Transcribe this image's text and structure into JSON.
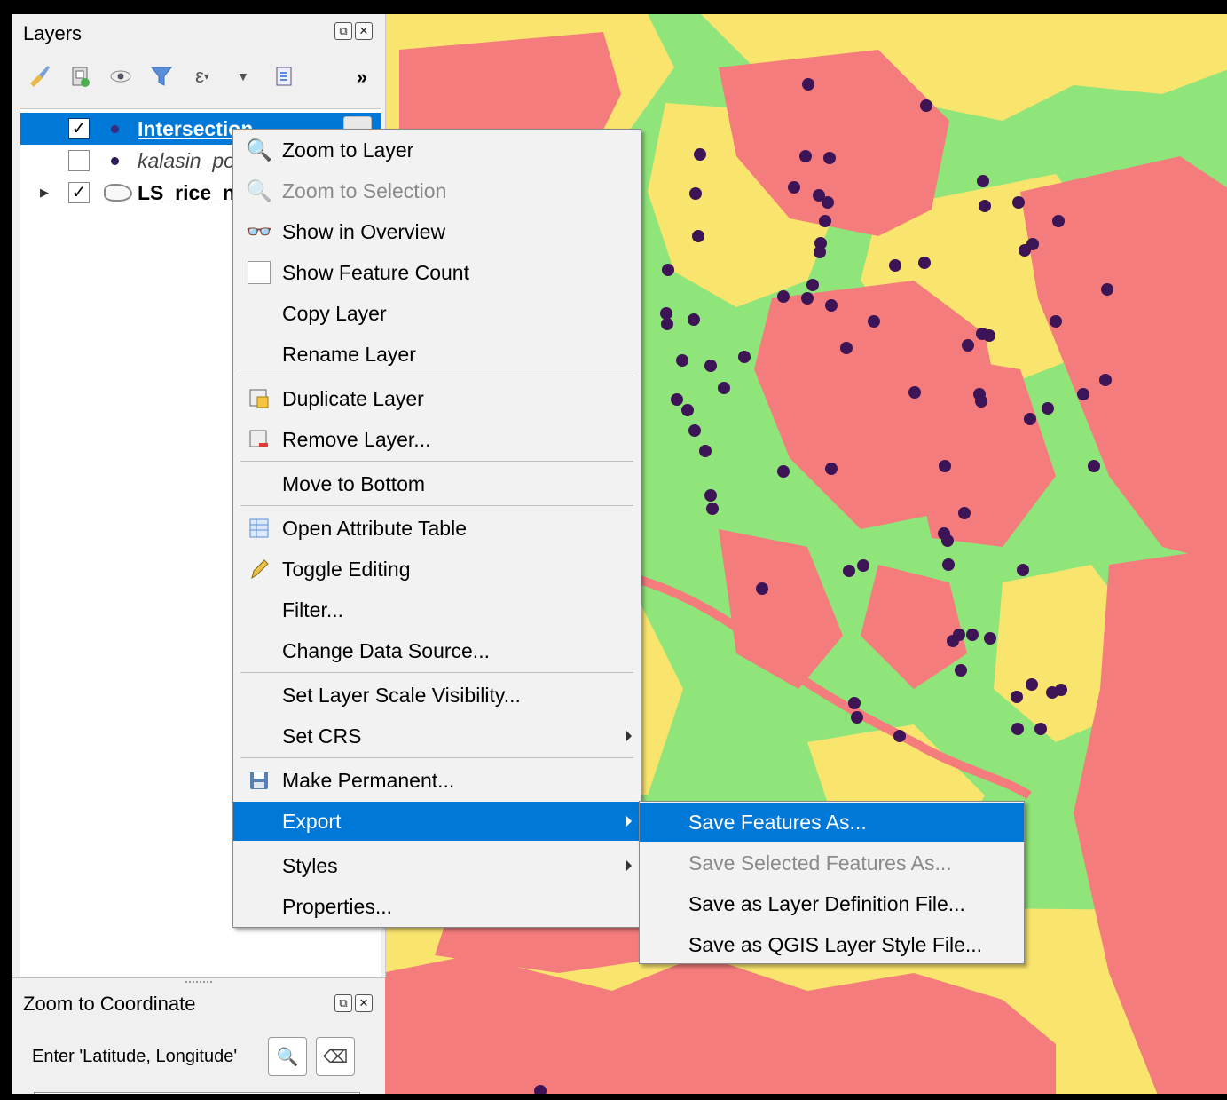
{
  "layers_panel": {
    "title": "Layers",
    "toolbar_icons": [
      "paintbrush-icon",
      "add-group-icon",
      "eye-icon",
      "filter-icon",
      "expression-filter-icon",
      "dropdown-icon",
      "collapse-all-icon"
    ],
    "more_label": "»",
    "layers": [
      {
        "name": "Intersection",
        "checked": true,
        "symbol": "point",
        "selected": true,
        "check_mark": "✓"
      },
      {
        "name": "kalasin_po",
        "checked": false,
        "symbol": "point",
        "selected": false,
        "check_mark": ""
      },
      {
        "name": "LS_rice_ne",
        "checked": true,
        "symbol": "polygon",
        "selected": false,
        "check_mark": "✓"
      }
    ]
  },
  "coord_panel": {
    "title": "Zoom to Coordinate",
    "label": "Enter 'Latitude, Longitude'",
    "input_value": ""
  },
  "context_menu": {
    "items": [
      {
        "label": "Zoom to Layer",
        "icon": "magnifier-icon",
        "disabled": false
      },
      {
        "label": "Zoom to Selection",
        "icon": "magnifier-icon",
        "disabled": true
      },
      {
        "label": "Show in Overview",
        "icon": "glasses-icon",
        "disabled": false
      },
      {
        "label": "Show Feature Count",
        "icon": "checkbox-icon",
        "disabled": false
      },
      {
        "label": "Copy Layer",
        "icon": "",
        "disabled": false
      },
      {
        "label": "Rename Layer",
        "icon": "",
        "disabled": false
      },
      {
        "label": "Duplicate Layer",
        "icon": "duplicate-icon",
        "disabled": false
      },
      {
        "label": "Remove Layer...",
        "icon": "remove-layer-icon",
        "disabled": false
      },
      {
        "label": "Move to Bottom",
        "icon": "",
        "disabled": false
      },
      {
        "label": "Open Attribute Table",
        "icon": "table-icon",
        "disabled": false
      },
      {
        "label": "Toggle Editing",
        "icon": "pencil-icon",
        "disabled": false
      },
      {
        "label": "Filter...",
        "icon": "",
        "disabled": false
      },
      {
        "label": "Change Data Source...",
        "icon": "",
        "disabled": false
      },
      {
        "label": "Set Layer Scale Visibility...",
        "icon": "",
        "disabled": false
      },
      {
        "label": "Set CRS",
        "icon": "",
        "disabled": false
      },
      {
        "label": "Make Permanent...",
        "icon": "save-icon",
        "disabled": false
      },
      {
        "label": "Export",
        "icon": "",
        "disabled": false
      },
      {
        "label": "Styles",
        "icon": "",
        "disabled": false
      },
      {
        "label": "Properties...",
        "icon": "",
        "disabled": false
      }
    ]
  },
  "export_submenu": {
    "items": [
      {
        "label": "Save Features As...",
        "disabled": false
      },
      {
        "label": "Save Selected Features As...",
        "disabled": true
      },
      {
        "label": "Save as Layer Definition File...",
        "disabled": false
      },
      {
        "label": "Save as QGIS Layer Style File...",
        "disabled": false
      }
    ]
  },
  "colors": {
    "map_high": "#f47c7c",
    "map_medium": "#f9e46e",
    "map_low": "#8fe47a",
    "point_fill": "#3d1456",
    "highlight": "#0078d7"
  }
}
